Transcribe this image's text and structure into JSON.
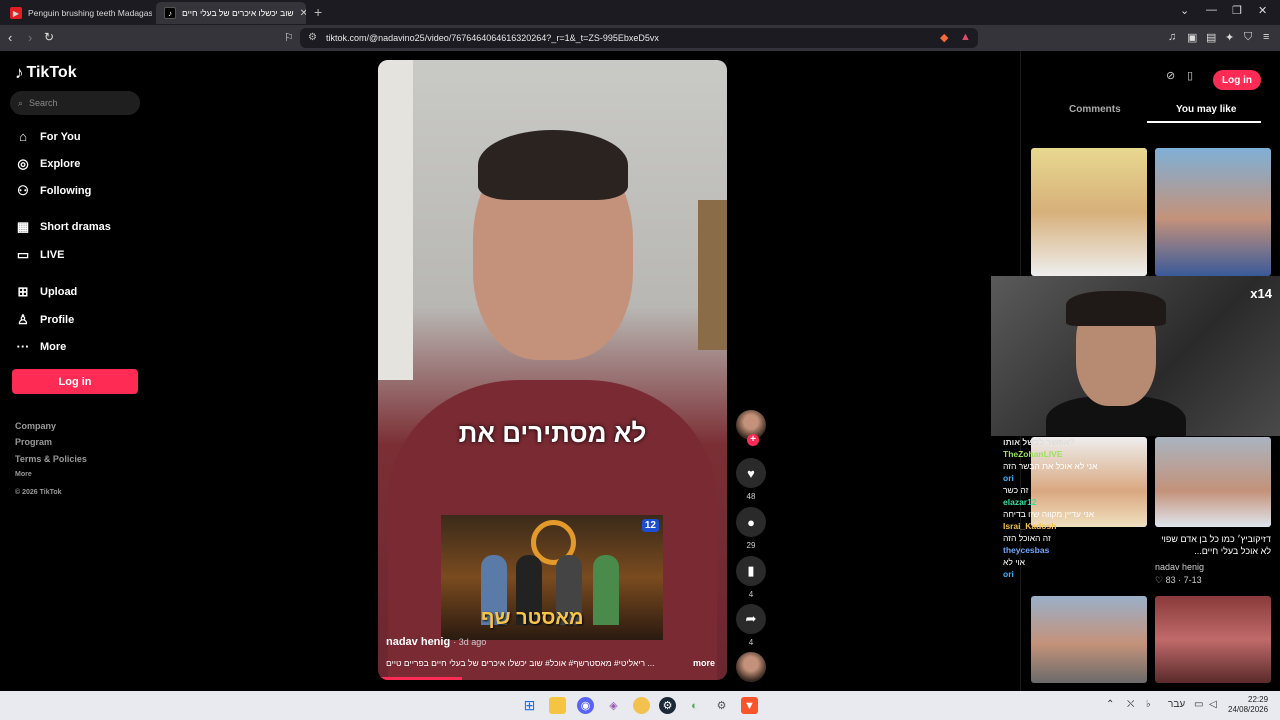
{
  "browser": {
    "tabs": [
      {
        "title": "Penguin brushing teeth Madagascar"
      },
      {
        "title": "שוב יכשלו איכרים של בעלי חיים"
      }
    ],
    "url": "tiktok.com/@nadavino25/video/7676464064616320264?_r=1&_t=ZS-995EbxeD5vx"
  },
  "sidebar": {
    "logo": "TikTok",
    "search_placeholder": "Search",
    "items": [
      {
        "label": "For You"
      },
      {
        "label": "Explore"
      },
      {
        "label": "Following"
      },
      {
        "label": "Short dramas"
      },
      {
        "label": "LIVE"
      },
      {
        "label": "Upload"
      },
      {
        "label": "Profile"
      },
      {
        "label": "More"
      }
    ],
    "login": "Log in",
    "footer": [
      "Company",
      "Program",
      "Terms & Policies",
      "More",
      "© 2026 TikTok"
    ]
  },
  "video": {
    "caption": "לא מסתירים את",
    "inset_title": "מאסטר שף",
    "inset_badge": "12",
    "author": "nadav henig",
    "ago": "· 3d ago",
    "description": "... ריאליטי# מאסטרשף# אוכל# שוב יכשלו איכרים של בעלי חיים בפריים טיים",
    "more": "more",
    "progress": 0.24
  },
  "actions": {
    "likes": "48",
    "comments": "29",
    "saves": "4",
    "shares": "4"
  },
  "right_panel": {
    "login": "Log in",
    "tabs": [
      "Comments",
      "You may like"
    ],
    "card1": {
      "title": "דזיקוביץ׳ כמו כל בן אדם שפוי לא אוכל בעלי חיים...",
      "author": "nadav henig",
      "stats": "♡ 83 · 7-13"
    }
  },
  "stream": {
    "multiplier": "x14"
  },
  "chat": [
    {
      "user": "אפשר לבשל אותו?",
      "color": "#ddd",
      "text": ""
    },
    {
      "user": "TheZohanLIVE",
      "color": "#9be15d",
      "text": "אני לא אוכל את הבשר הזה"
    },
    {
      "user": "ori",
      "color": "#3fb6ff",
      "text": "זה כשר"
    },
    {
      "user": "elazar12",
      "color": "#39e0a0",
      "text": "אני עדיין מקווה שזו בדיחה"
    },
    {
      "user": "Israi_Kadosh",
      "color": "#f2c14e",
      "text": "זה האוכל הזה"
    },
    {
      "user": "theycesbas",
      "color": "#6fa8ff",
      "text": "אוי לא"
    },
    {
      "user": "ori",
      "color": "#3fb6ff",
      "text": ""
    }
  ],
  "taskbar": {
    "time": "22:29",
    "date": "24/08/2026",
    "lang": "עבר"
  }
}
